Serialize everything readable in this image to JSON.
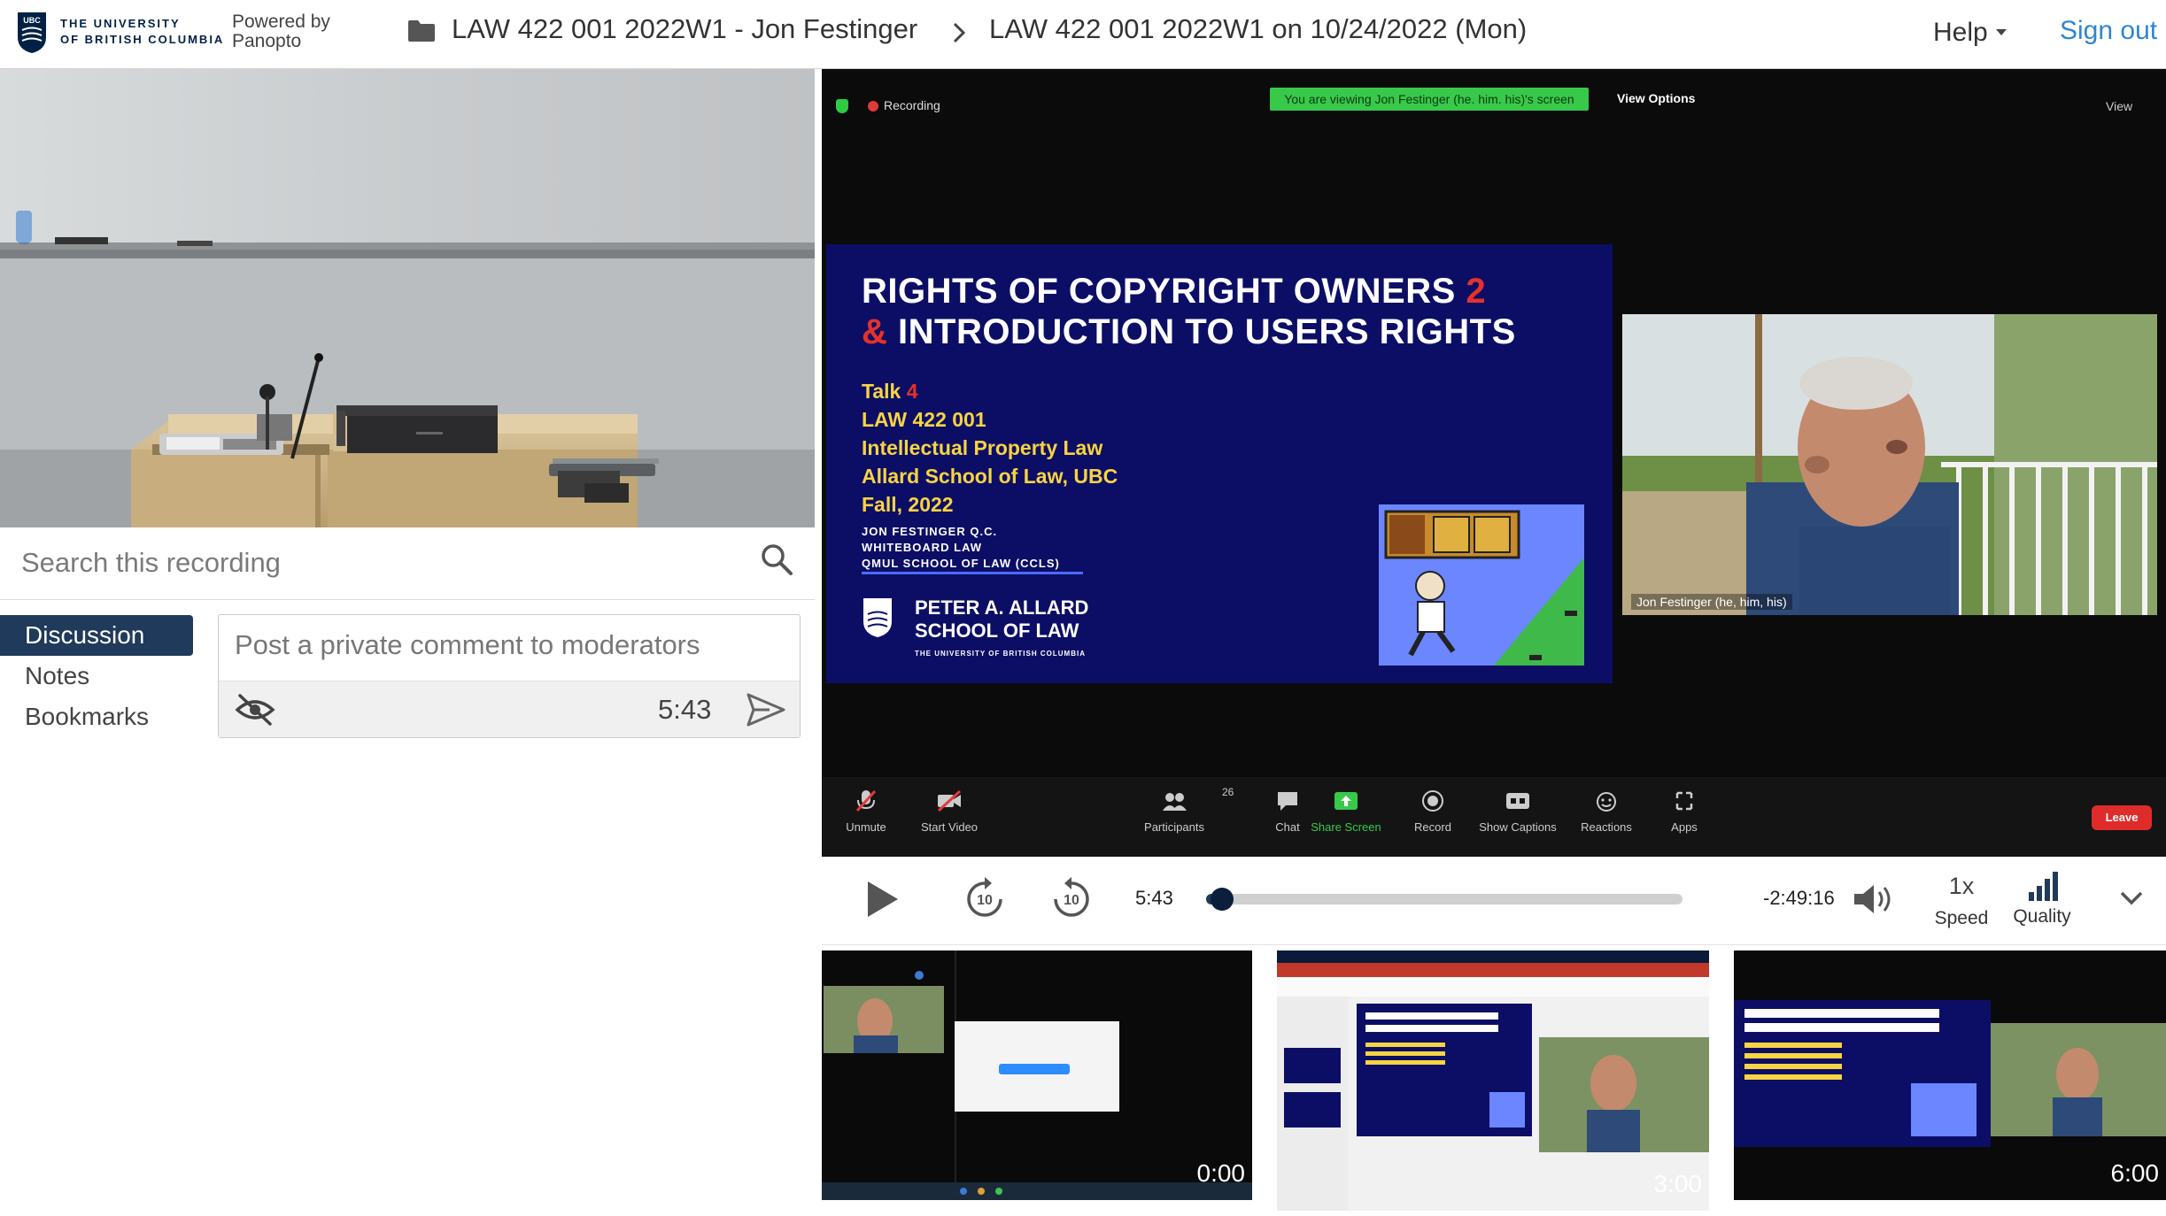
{
  "header": {
    "university_line1": "THE UNIVERSITY",
    "university_line2": "OF BRITISH COLUMBIA",
    "ubc_mark": "UBC",
    "powered_line1": "Powered by",
    "powered_line2": "Panopto",
    "breadcrumb_course": "LAW 422 001 2022W1 - Jon Festinger",
    "breadcrumb_session": "LAW 422 001 2022W1 on 10/24/2022 (Mon)",
    "help_label": "Help",
    "signout_label": "Sign out"
  },
  "search": {
    "placeholder": "Search this recording"
  },
  "tabs": [
    {
      "label": "Discussion",
      "active": true
    },
    {
      "label": "Notes",
      "active": false
    },
    {
      "label": "Bookmarks",
      "active": false
    }
  ],
  "comment": {
    "placeholder": "Post a private comment to moderators",
    "timestamp": "5:43"
  },
  "zoom": {
    "recording_label": "Recording",
    "viewing_banner": "You are viewing Jon Festinger (he. him. his)'s screen",
    "view_options": "View Options",
    "view_label": "View",
    "speaker_name": "Jon Festinger (he, him, his)",
    "participants_count": "26",
    "buttons": [
      "Unmute",
      "Start Video",
      "Participants",
      "Chat",
      "Share Screen",
      "Record",
      "Show Captions",
      "Reactions",
      "Apps"
    ],
    "leave_label": "Leave"
  },
  "slide": {
    "title_line1": "RIGHTS OF COPYRIGHT OWNERS",
    "title_num": "2",
    "title_amp": "&",
    "title_line2": "INTRODUCTION TO USERS RIGHTS",
    "talk": "Talk",
    "talk_num": "4",
    "course": "LAW 422 001",
    "subject": "Intellectual Property Law",
    "school": "Allard School of Law, UBC",
    "term": "Fall, 2022",
    "author1": "JON FESTINGER Q.C.",
    "author2": "WHITEBOARD LAW",
    "author3": "QMUL SCHOOL OF LAW (CCLS)",
    "allard1": "PETER A. ALLARD",
    "allard2": "SCHOOL OF LAW",
    "allard_sub": "THE UNIVERSITY OF BRITISH COLUMBIA"
  },
  "player": {
    "current_time": "5:43",
    "remaining_time": "-2:49:16",
    "progress_fraction": 0.033,
    "speed_value": "1x",
    "speed_label": "Speed",
    "quality_label": "Quality",
    "skip_seconds": "10"
  },
  "thumbnails": [
    {
      "time": "0:00"
    },
    {
      "time": "3:00"
    },
    {
      "time": "6:00"
    }
  ],
  "colors": {
    "ubc_navy": "#002145",
    "active_tab": "#1f3a5a",
    "link_blue": "#2f86d1",
    "slide_blue": "#0c0e66",
    "slide_yellow": "#f7d442",
    "slide_red": "#e4322b",
    "zoom_green": "#38c94a",
    "leave_red": "#e02b2b"
  },
  "icons": {
    "folder": "folder-icon",
    "breadcrumb_separator": "chevron-right-icon",
    "search": "search-icon",
    "private_visibility": "eye-off-icon",
    "send": "send-icon",
    "play": "play-icon",
    "rewind": "rewind-10-icon",
    "forward": "forward-10-icon",
    "volume": "volume-icon",
    "quality": "signal-bars-icon",
    "expand": "chevron-down-icon"
  }
}
